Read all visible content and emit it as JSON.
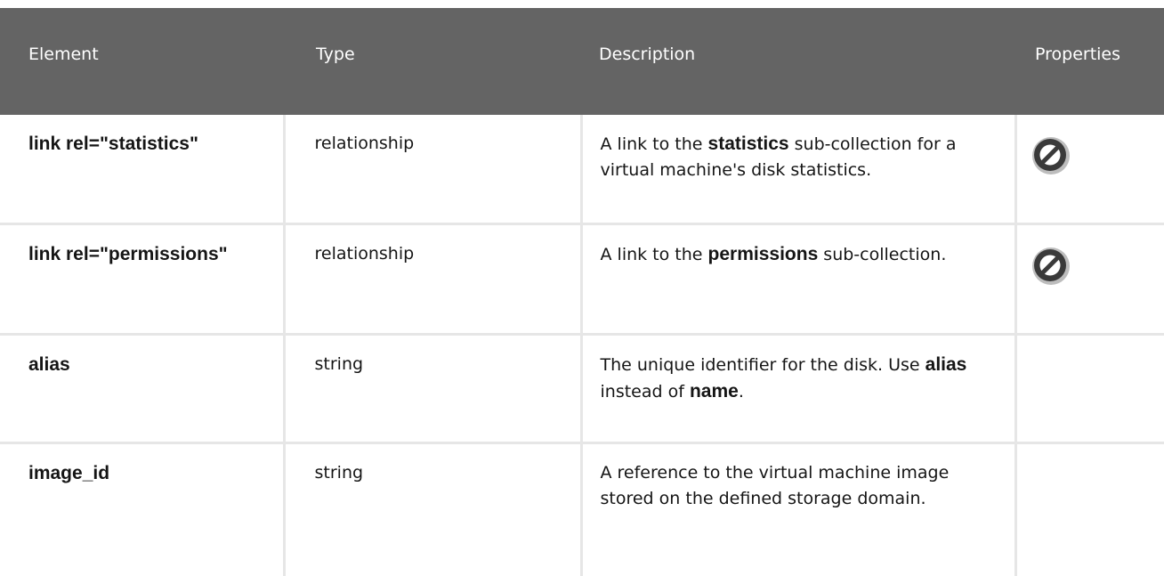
{
  "table": {
    "headers": [
      "Element",
      "Type",
      "Description",
      "Properties"
    ],
    "rows": [
      {
        "element": "link rel=\"statistics\"",
        "type": "relationship",
        "desc_a": "A link to the",
        "desc_b": "statistics",
        "desc_c": "sub-collection for a virtual machine's disk statistics.",
        "property_icon": "read-only-icon"
      },
      {
        "element": "link rel=\"permissions\"",
        "type": "relationship",
        "desc_a": "A link to the",
        "desc_b": "permissions",
        "desc_c": "sub-collection.",
        "property_icon": "read-only-icon"
      },
      {
        "element": "alias",
        "type": "string",
        "desc_a": "The unique identifier for the disk. Use",
        "desc_b": "alias",
        "desc_c": "instead of",
        "desc_d": "name",
        "desc_e": "."
      },
      {
        "element": "image_id",
        "type": "string",
        "desc_a": "A reference to the virtual machine image stored on the defined storage domain."
      }
    ]
  },
  "colors": {
    "header_bg": "#646464",
    "header_text": "#ffffff",
    "border": "#e6e6e6",
    "icon_ring": "#3a3a3a"
  }
}
